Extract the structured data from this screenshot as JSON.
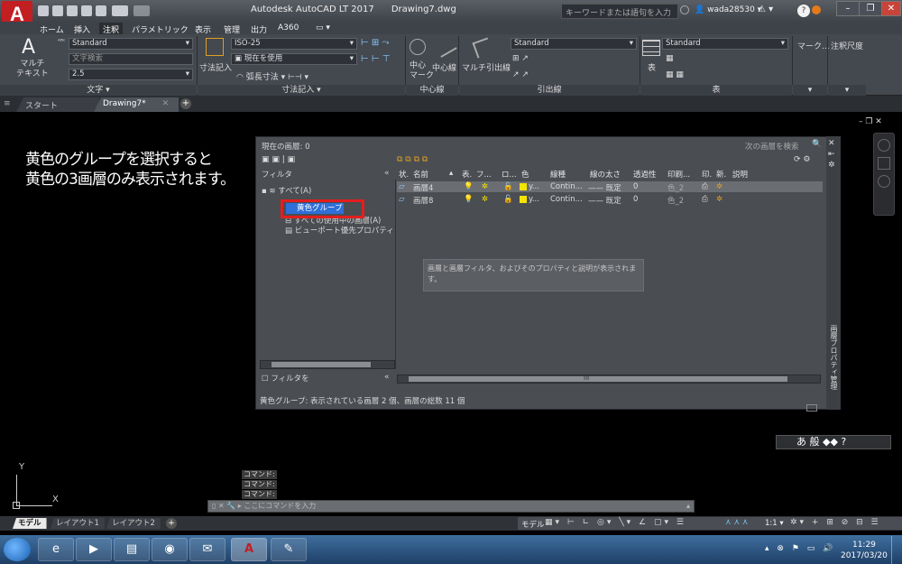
{
  "title": {
    "app": "Autodesk AutoCAD LT 2017",
    "file": "Drawing7.dwg",
    "search_placeholder": "キーワードまたは語句を入力",
    "user": "wada28530",
    "logo_letters": "A",
    "logo_sub": "LT"
  },
  "menu": [
    "ホーム",
    "挿入",
    "注釈",
    "パラメトリック",
    "表示",
    "管理",
    "出力",
    "A360"
  ],
  "menu_active": "注釈",
  "ribbon": {
    "text_panel": {
      "big_label1": "マルチ",
      "big_label2": "テキスト",
      "style": "Standard",
      "find": "文字検索",
      "height": "2.5",
      "title": "文字 ▾"
    },
    "dim_panel": {
      "big_label": "寸法記入",
      "style": "ISO-25",
      "use_current": "現在を使用",
      "arc": "弧長寸法",
      "title": "寸法記入 ▾"
    },
    "center_panel": {
      "mark_label1": "中心",
      "mark_label2": "マーク",
      "line_label": "中心線",
      "title": "中心線"
    },
    "leader_panel": {
      "big_label": "マルチ引出線",
      "style": "Standard",
      "title": "引出線"
    },
    "table_panel": {
      "big_label": "表",
      "style": "Standard",
      "title": "表"
    },
    "markup_label": "マーク...",
    "scale_label": "注釈尺度"
  },
  "tabs": {
    "start": "スタート",
    "doc": "Drawing7*"
  },
  "annotation": {
    "line1": "黄色のグループを選択すると",
    "line2": "黄色の3画層のみ表示されます。"
  },
  "layer_manager": {
    "current_layer": "現在の画層: 0",
    "search_placeholder": "次の画層を検索",
    "filter_header": "フィルタ",
    "filter_all": "すべて(A)",
    "filter_yellow": "黄色グループ",
    "filter_used": "すべての使用中の画層(A)",
    "filter_viewport": "ビューポート優先プロパティ",
    "invert_filter": "フィルタを",
    "columns": [
      "状.",
      "名前",
      "表.",
      "フ...",
      "ロ...",
      "色",
      "線種",
      "線の太さ",
      "透過性",
      "印刷...",
      "印.",
      "新.",
      "説明"
    ],
    "layers": [
      {
        "name": "画層4",
        "color": "y...",
        "linetype": "Contin...",
        "lineweight": "—— 既定",
        "transparency": "0",
        "plot_style": "色_2"
      },
      {
        "name": "画層8",
        "color": "y...",
        "linetype": "Contin...",
        "lineweight": "—— 既定",
        "transparency": "0",
        "plot_style": "色_2"
      }
    ],
    "info_text": "画層と画層フィルタ、およびそのプロパティと説明が表示されます。",
    "status_text": "黄色グループ: 表示されている画層 2 個、画層の総数 11 個",
    "side_title": "画層プロパティ管理",
    "scroll_marker": "III"
  },
  "command": {
    "history": [
      "コマンド:",
      "コマンド:",
      "コマンド:"
    ],
    "placeholder": "ここにコマンドを入力"
  },
  "ucs": {
    "y": "Y",
    "x": "X"
  },
  "layouts": [
    "モデル",
    "レイアウト1",
    "レイアウト2"
  ],
  "status_scale": "1:1",
  "status_model": "モデル",
  "ime": "あ 般",
  "clock": {
    "time": "11:29",
    "date": "2017/03/20"
  },
  "colors": {
    "accent_red": "#e41e1e",
    "selection_blue": "#2f6fd8",
    "layer_yellow": "#f5e400"
  }
}
